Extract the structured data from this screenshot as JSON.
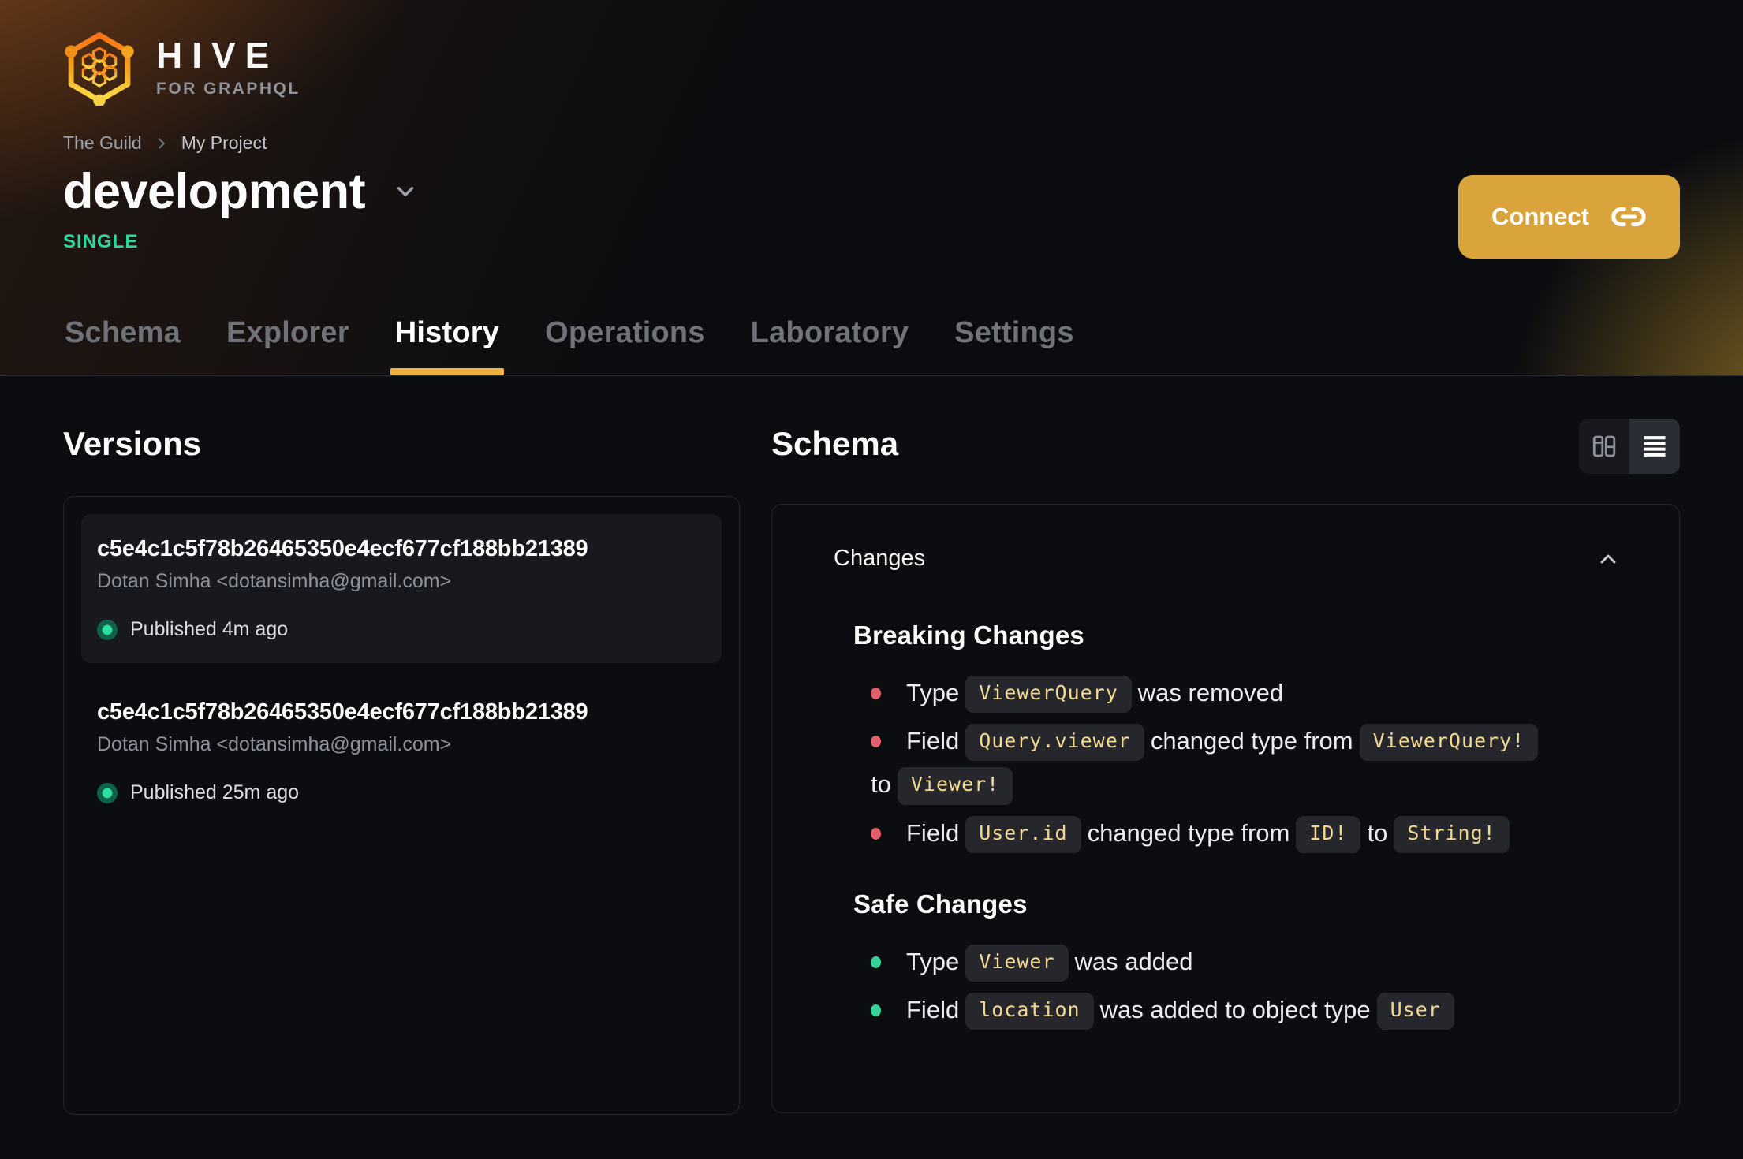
{
  "brand": {
    "name": "HIVE",
    "tagline": "FOR GRAPHQL"
  },
  "breadcrumb": [
    "The Guild",
    "My Project"
  ],
  "target": {
    "title": "development",
    "badge": "SINGLE"
  },
  "connect": {
    "label": "Connect"
  },
  "tabs": [
    {
      "label": "Schema",
      "active": false
    },
    {
      "label": "Explorer",
      "active": false
    },
    {
      "label": "History",
      "active": true
    },
    {
      "label": "Operations",
      "active": false
    },
    {
      "label": "Laboratory",
      "active": false
    },
    {
      "label": "Settings",
      "active": false
    }
  ],
  "versions": {
    "heading": "Versions",
    "items": [
      {
        "hash": "c5e4c1c5f78b26465350e4ecf677cf188bb21389",
        "author": "Dotan Simha <dotansimha@gmail.com>",
        "status": "Published 4m ago",
        "highlighted": true
      },
      {
        "hash": "c5e4c1c5f78b26465350e4ecf677cf188bb21389",
        "author": "Dotan Simha <dotansimha@gmail.com>",
        "status": "Published 25m ago",
        "highlighted": false
      }
    ]
  },
  "schema": {
    "heading": "Schema",
    "panel_title": "Changes",
    "sections": [
      {
        "title": "Breaking Changes",
        "bullet_color": "#e2606c",
        "items": [
          {
            "segments": [
              {
                "type": "text",
                "value": "Type"
              },
              {
                "type": "code",
                "value": "ViewerQuery"
              },
              {
                "type": "text",
                "value": "was removed"
              }
            ]
          },
          {
            "segments": [
              {
                "type": "text",
                "value": "Field"
              },
              {
                "type": "code",
                "value": "Query.viewer"
              },
              {
                "type": "text",
                "value": "changed type from"
              },
              {
                "type": "code",
                "value": "ViewerQuery!"
              },
              {
                "type": "group",
                "text": "to",
                "code": "Viewer!"
              }
            ]
          },
          {
            "segments": [
              {
                "type": "text",
                "value": "Field"
              },
              {
                "type": "code",
                "value": "User.id"
              },
              {
                "type": "text",
                "value": "changed type from"
              },
              {
                "type": "code",
                "value": "ID!"
              },
              {
                "type": "text",
                "value": "to"
              },
              {
                "type": "code",
                "value": "String!"
              }
            ]
          }
        ]
      },
      {
        "title": "Safe Changes",
        "bullet_color": "#34d399",
        "items": [
          {
            "segments": [
              {
                "type": "text",
                "value": "Type"
              },
              {
                "type": "code",
                "value": "Viewer"
              },
              {
                "type": "text",
                "value": "was added"
              }
            ]
          },
          {
            "segments": [
              {
                "type": "text",
                "value": "Field"
              },
              {
                "type": "code",
                "value": "location"
              },
              {
                "type": "text",
                "value": "was added to object type"
              },
              {
                "type": "code",
                "value": "User"
              }
            ]
          }
        ]
      }
    ]
  },
  "colors": {
    "accent_button": "#d9a43c",
    "tab_underline": "#f0b13f",
    "badge_green": "#2fd6a0",
    "code_text": "#f2d891",
    "breaking_bullet": "#e2606c",
    "safe_bullet": "#34d399"
  }
}
